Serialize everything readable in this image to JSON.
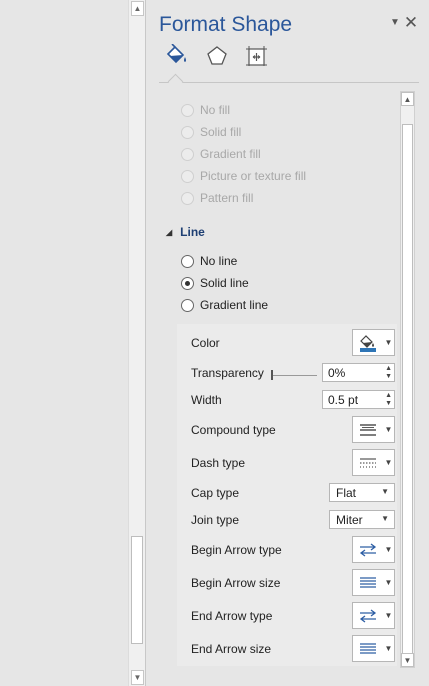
{
  "pane": {
    "title": "Format Shape"
  },
  "tabs": [
    {
      "name": "fill-line-tab",
      "icon": "paint-bucket-icon",
      "selected": true
    },
    {
      "name": "effects-tab",
      "icon": "pentagon-icon",
      "selected": false
    },
    {
      "name": "size-properties-tab",
      "icon": "size-properties-icon",
      "selected": false
    }
  ],
  "fill_options": [
    "No fill",
    "Solid fill",
    "Gradient fill",
    "Picture or texture fill",
    "Pattern fill"
  ],
  "line_section": {
    "label": "Line",
    "options": [
      "No line",
      "Solid line",
      "Gradient line"
    ],
    "selected": "Solid line"
  },
  "props": {
    "color_label": "Color",
    "transparency_label": "Transparency",
    "transparency_value": "0%",
    "transparency_fraction": 0,
    "width_label": "Width",
    "width_value": "0.5 pt",
    "compound_label": "Compound type",
    "dash_label": "Dash type",
    "cap_label": "Cap type",
    "cap_value": "Flat",
    "join_label": "Join type",
    "join_value": "Miter",
    "begin_arrow_type_label": "Begin Arrow type",
    "begin_arrow_size_label": "Begin Arrow size",
    "end_arrow_type_label": "End Arrow type",
    "end_arrow_size_label": "End Arrow size"
  },
  "colors": {
    "title": "#2b579a",
    "accent": "#1e3f73",
    "fill_swatch": "#2e75b6"
  }
}
